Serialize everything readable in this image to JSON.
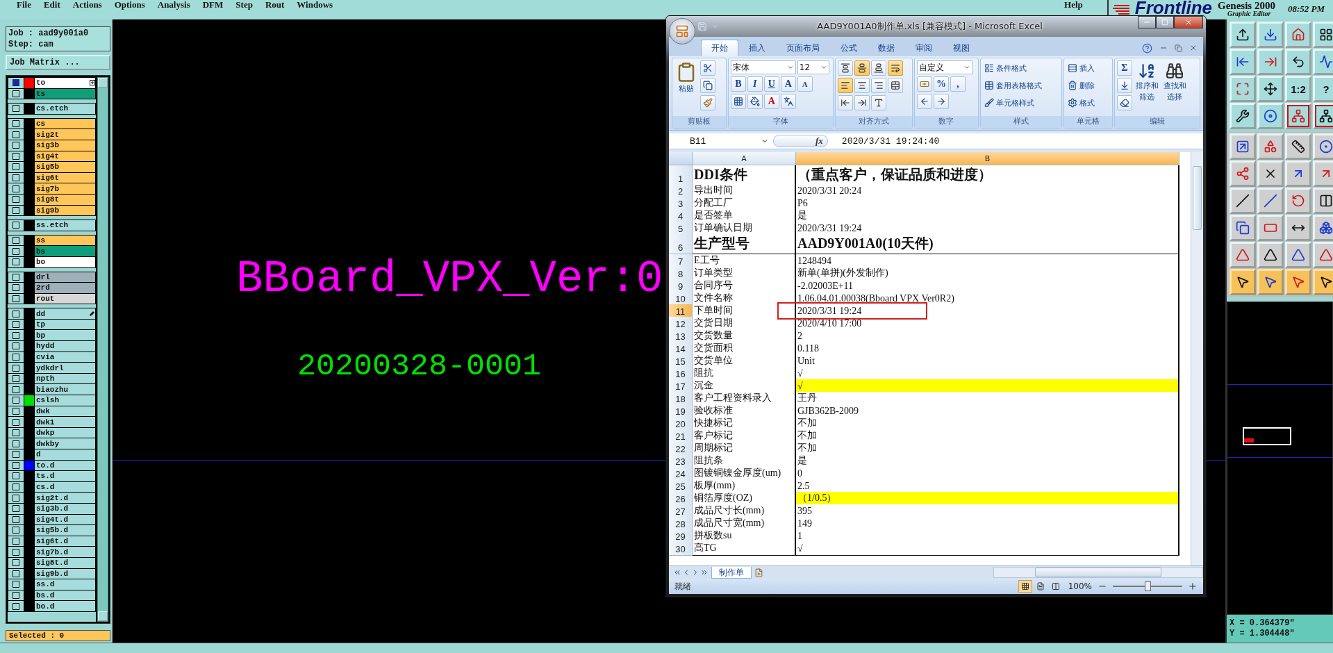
{
  "menu": {
    "items": [
      "File",
      "Edit",
      "Actions",
      "Options",
      "Analysis",
      "DFM",
      "Step",
      "Rout",
      "Windows"
    ],
    "help": "Help",
    "logo": "Frontline",
    "product": "Genesis 2000",
    "subtitle": "Graphic Editor",
    "time": "08:52 PM"
  },
  "left_panel": {
    "job": "Job : aad9y001a0",
    "step": "Step: cam",
    "matrix_button": "Job Matrix ...",
    "selected_count": "Selected : 0",
    "layer_groups": [
      {
        "layers": [
          {
            "name": "to",
            "color": "#ffffff",
            "marker": {
              "color": "#ff0000"
            },
            "checked": true
          },
          {
            "name": "ts",
            "color": "#0f9e7a",
            "checked": false
          }
        ]
      },
      {
        "layers": [
          {
            "name": "cs.etch",
            "color": "#a6dcdc",
            "checked": false
          }
        ]
      },
      {
        "layers": [
          {
            "name": "cs",
            "color": "#ffc65a",
            "checked": false
          },
          {
            "name": "sig2t",
            "color": "#ffc65a",
            "checked": false
          },
          {
            "name": "sig3b",
            "color": "#ffc65a",
            "checked": false
          },
          {
            "name": "sig4t",
            "color": "#ffc65a",
            "checked": false
          },
          {
            "name": "sig5b",
            "color": "#ffc65a",
            "checked": false
          },
          {
            "name": "sig6t",
            "color": "#ffc65a",
            "checked": false
          },
          {
            "name": "sig7b",
            "color": "#ffc65a",
            "checked": false
          },
          {
            "name": "sig8t",
            "color": "#ffc65a",
            "checked": false
          },
          {
            "name": "sig9b",
            "color": "#ffc65a",
            "checked": false
          }
        ]
      },
      {
        "layers": [
          {
            "name": "ss.etch",
            "color": "#a6dcdc",
            "checked": false
          }
        ]
      },
      {
        "layers": [
          {
            "name": "ss",
            "color": "#ffc65a",
            "checked": false
          },
          {
            "name": "bs",
            "color": "#0f9e7a",
            "checked": false
          },
          {
            "name": "bo",
            "color": "#ffffff",
            "checked": false
          }
        ]
      },
      {
        "layers": [
          {
            "name": "drl",
            "color": "#9fb0b8",
            "checked": false
          },
          {
            "name": "2rd",
            "color": "#9fb0b8",
            "checked": false
          },
          {
            "name": "rout",
            "color": "#d8d8d8",
            "checked": false
          }
        ]
      },
      {
        "layers": [
          {
            "name": "dd",
            "color": "#a6dcdc",
            "checked": false
          },
          {
            "name": "tp",
            "color": "#a6dcdc",
            "checked": false
          },
          {
            "name": "bp",
            "color": "#a6dcdc",
            "checked": false
          },
          {
            "name": "hydd",
            "color": "#a6dcdc",
            "checked": false
          },
          {
            "name": "cvia",
            "color": "#a6dcdc",
            "checked": false
          },
          {
            "name": "ydkdrl",
            "color": "#a6dcdc",
            "checked": false
          },
          {
            "name": "npth",
            "color": "#a6dcdc",
            "checked": false
          },
          {
            "name": "biaozhu",
            "color": "#a6dcdc",
            "checked": false
          },
          {
            "name": "cslsh",
            "color": "#a6dcdc",
            "marker": {
              "color": "#00dd00"
            },
            "checked": false
          },
          {
            "name": "dwk",
            "color": "#a6dcdc",
            "checked": false
          },
          {
            "name": "dwk1",
            "color": "#a6dcdc",
            "checked": false
          },
          {
            "name": "dwkp",
            "color": "#a6dcdc",
            "checked": false
          },
          {
            "name": "dwkby",
            "color": "#a6dcdc",
            "checked": false
          },
          {
            "name": "d",
            "color": "#a6dcdc",
            "checked": false
          },
          {
            "name": "to.d",
            "color": "#a6dcdc",
            "marker": {
              "color": "#0000ff"
            },
            "checked": false
          },
          {
            "name": "ts.d",
            "color": "#a6dcdc",
            "checked": false
          },
          {
            "name": "cs.d",
            "color": "#a6dcdc",
            "checked": false
          },
          {
            "name": "sig2t.d",
            "color": "#a6dcdc",
            "checked": false
          },
          {
            "name": "sig3b.d",
            "color": "#a6dcdc",
            "checked": false
          },
          {
            "name": "sig4t.d",
            "color": "#a6dcdc",
            "checked": false
          },
          {
            "name": "sig5b.d",
            "color": "#a6dcdc",
            "checked": false
          },
          {
            "name": "sig6t.d",
            "color": "#a6dcdc",
            "checked": false
          },
          {
            "name": "sig7b.d",
            "color": "#a6dcdc",
            "checked": false
          },
          {
            "name": "sig8t.d",
            "color": "#a6dcdc",
            "checked": false
          },
          {
            "name": "sig9b.d",
            "color": "#a6dcdc",
            "checked": false
          },
          {
            "name": "ss.d",
            "color": "#a6dcdc",
            "checked": false
          },
          {
            "name": "bs.d",
            "color": "#a6dcdc",
            "checked": false
          },
          {
            "name": "bo.d",
            "color": "#a6dcdc",
            "checked": false
          }
        ]
      }
    ]
  },
  "canvas": {
    "texts": [
      {
        "kind": "title",
        "text": "BBoard_VPX_Ver:0",
        "color": "#ff00ff"
      },
      {
        "kind": "code",
        "text": "20200328-0001",
        "color": "#00e000"
      }
    ]
  },
  "tool_groups": [
    {
      "buttons": [
        {
          "selected": false,
          "flagged": false
        },
        {
          "selected": false,
          "flagged": false
        },
        {
          "selected": false,
          "flagged": false
        },
        {
          "selected": false,
          "flagged": false
        },
        {
          "selected": false,
          "flagged": false
        },
        {
          "selected": false,
          "flagged": false
        },
        {
          "selected": false,
          "flagged": false
        },
        {
          "selected": false,
          "flagged": false
        },
        {
          "selected": false,
          "flagged": false
        },
        {
          "selected": false,
          "flagged": false
        },
        {
          "selected": false,
          "flagged": false,
          "label": "1:2"
        },
        {
          "selected": false,
          "flagged": false,
          "label": "?"
        },
        {
          "selected": false,
          "flagged": false
        },
        {
          "selected": false,
          "flagged": false
        },
        {
          "selected": false,
          "flagged": true
        },
        {
          "selected": false,
          "flagged": true
        }
      ]
    },
    {
      "buttons": [
        {
          "selected": false,
          "flagged": false
        },
        {
          "selected": false,
          "flagged": false
        },
        {
          "selected": false,
          "flagged": false
        },
        {
          "selected": false,
          "flagged": false
        },
        {
          "selected": false,
          "flagged": false
        },
        {
          "selected": false,
          "flagged": false
        },
        {
          "selected": false,
          "flagged": false
        },
        {
          "selected": false,
          "flagged": false
        },
        {
          "selected": false,
          "flagged": false
        },
        {
          "selected": false,
          "flagged": false
        },
        {
          "selected": false,
          "flagged": false
        },
        {
          "selected": false,
          "flagged": false
        },
        {
          "selected": false,
          "flagged": false
        },
        {
          "selected": false,
          "flagged": false
        },
        {
          "selected": false,
          "flagged": false
        },
        {
          "selected": false,
          "flagged": false
        },
        {
          "selected": false,
          "flagged": false
        },
        {
          "selected": false,
          "flagged": false
        },
        {
          "selected": false,
          "flagged": false
        },
        {
          "selected": false,
          "flagged": false
        },
        {
          "selected": true,
          "flagged": false
        },
        {
          "selected": true,
          "flagged": false
        },
        {
          "selected": true,
          "flagged": false
        },
        {
          "selected": true,
          "flagged": false
        }
      ]
    }
  ],
  "coordinates": {
    "x": "X = 0.364379\"",
    "y": "Y = 1.304448\""
  },
  "excel": {
    "title": "AAD9Y001A0制作单.xls  [兼容模式] - Microsoft Excel",
    "tabs": [
      {
        "label": "开始",
        "selected": true
      },
      {
        "label": "插入",
        "selected": false
      },
      {
        "label": "页面布局",
        "selected": false
      },
      {
        "label": "公式",
        "selected": false
      },
      {
        "label": "数据",
        "selected": false
      },
      {
        "label": "审阅",
        "selected": false
      },
      {
        "label": "视图",
        "selected": false
      }
    ],
    "groups": [
      {
        "kind": "clipboard",
        "label": "剪贴板",
        "paste": "粘贴"
      },
      {
        "kind": "font",
        "label": "字体",
        "font": "宋体",
        "size": "12",
        "bold": "B",
        "italic": "I",
        "underline": "U",
        "grow": "A",
        "shrink": "A",
        "font_color": "A"
      },
      {
        "kind": "alignment",
        "label": "对齐方式",
        "buttons": [
          {
            "selected": false
          },
          {
            "selected": true
          },
          {
            "selected": false
          },
          {
            "selected": true
          },
          {
            "selected": true
          },
          {
            "selected": false
          },
          {
            "selected": false
          },
          {
            "selected": false
          },
          {
            "selected": false
          },
          {
            "selected": false
          },
          {
            "selected": false
          }
        ]
      },
      {
        "kind": "number",
        "label": "数字",
        "format": "自定义",
        "percent": "%",
        "comma": ","
      },
      {
        "kind": "styles",
        "label": "样式",
        "items": [
          "条件格式",
          "套用表格格式",
          "单元格样式"
        ]
      },
      {
        "kind": "cells",
        "label": "单元格",
        "items": [
          "插入",
          "删除",
          "格式"
        ]
      },
      {
        "kind": "editing",
        "label": "编辑",
        "sum": "Σ",
        "sort": [
          "排序和",
          "筛选"
        ],
        "find": [
          "查找和",
          "选择"
        ]
      }
    ],
    "name_box": "B11",
    "function_label": "fx",
    "formula": "2020/3/31  19:24:40",
    "columns": [
      {
        "label": "A",
        "selected": false
      },
      {
        "label": "B",
        "selected": true
      }
    ],
    "rows": [
      {
        "number": "1",
        "kind": "title",
        "a": "DDI条件",
        "b": "（重点客户，保证品质和进度）",
        "selected": false,
        "boxed": false
      },
      {
        "number": "2",
        "kind": "field",
        "a": "导出时间",
        "b": "2020/3/31 20:24",
        "selected": false,
        "boxed": false
      },
      {
        "number": "3",
        "kind": "field",
        "a": "分配工厂",
        "b": "P6",
        "selected": false,
        "boxed": false
      },
      {
        "number": "4",
        "kind": "field",
        "a": "是否签单",
        "b": "是",
        "selected": false,
        "boxed": false
      },
      {
        "number": "5",
        "kind": "field",
        "a": "订单确认日期",
        "b": "2020/3/31 19:24",
        "selected": false,
        "boxed": false
      },
      {
        "number": "6",
        "kind": "title",
        "a": "生产型号",
        "b": "AAD9Y001A0(10天件)",
        "selected": false,
        "boxed": false
      },
      {
        "number": "7",
        "kind": "field",
        "a": "E工号",
        "b": "1248494",
        "selected": false,
        "boxed": false
      },
      {
        "number": "8",
        "kind": "field",
        "a": "订单类型",
        "b": "新单(单拼)(外发制作)",
        "selected": false,
        "boxed": false
      },
      {
        "number": "9",
        "kind": "field",
        "a": "合同序号",
        "b": "-2.02003E+11",
        "selected": false,
        "boxed": false
      },
      {
        "number": "10",
        "kind": "field",
        "a": "文件名称",
        "b": "1.06.04.01.00038(Bboard VPX Ver0R2)",
        "selected": false,
        "boxed": false
      },
      {
        "number": "11",
        "kind": "field",
        "a": "下单时间",
        "b": "2020/3/31 19:24",
        "selected": true,
        "boxed": true
      },
      {
        "number": "12",
        "kind": "field",
        "a": "交货日期",
        "b": "2020/4/10 17:00",
        "selected": false,
        "boxed": false
      },
      {
        "number": "13",
        "kind": "field",
        "a": "交货数量",
        "b": "2",
        "selected": false,
        "boxed": false
      },
      {
        "number": "14",
        "kind": "field",
        "a": "交货面积",
        "b": "0.118",
        "selected": false,
        "boxed": false
      },
      {
        "number": "15",
        "kind": "field",
        "a": "交货单位",
        "b": "Unit",
        "selected": false,
        "boxed": false
      },
      {
        "number": "16",
        "kind": "field",
        "a": "阻抗",
        "b": "√",
        "selected": false,
        "boxed": false
      },
      {
        "number": "17",
        "kind": "field",
        "a": "沉金",
        "b": "√",
        "color": "#ffff00",
        "selected": false,
        "boxed": false
      },
      {
        "number": "18",
        "kind": "field",
        "a": "客户工程资料录入",
        "b": "王丹",
        "selected": false,
        "boxed": false
      },
      {
        "number": "19",
        "kind": "field",
        "a": "验收标准",
        "b": "GJB362B-2009",
        "selected": false,
        "boxed": false
      },
      {
        "number": "20",
        "kind": "field",
        "a": "快捷标记",
        "b": "不加",
        "selected": false,
        "boxed": false
      },
      {
        "number": "21",
        "kind": "field",
        "a": "客户标记",
        "b": "不加",
        "selected": false,
        "boxed": false
      },
      {
        "number": "22",
        "kind": "field",
        "a": "周期标记",
        "b": "不加",
        "selected": false,
        "boxed": false
      },
      {
        "number": "23",
        "kind": "field",
        "a": "阻抗条",
        "b": "是",
        "selected": false,
        "boxed": false
      },
      {
        "number": "24",
        "kind": "field",
        "a": "图镀铜镍金厚度(um)",
        "b": "0",
        "selected": false,
        "boxed": false
      },
      {
        "number": "25",
        "kind": "field",
        "a": "板厚(mm)",
        "b": "2.5",
        "selected": false,
        "boxed": false
      },
      {
        "number": "26",
        "kind": "field",
        "a": "铜箔厚度(OZ)",
        "b": "（1/0.5）",
        "color": "#ffff00",
        "selected": false,
        "boxed": false
      },
      {
        "number": "27",
        "kind": "field",
        "a": "成品尺寸长(mm)",
        "b": "395",
        "selected": false,
        "boxed": false
      },
      {
        "number": "28",
        "kind": "field",
        "a": "成品尺寸宽(mm)",
        "b": "149",
        "selected": false,
        "boxed": false
      },
      {
        "number": "29",
        "kind": "field",
        "a": "拼板数su",
        "b": "1",
        "selected": false,
        "boxed": false
      },
      {
        "number": "30",
        "kind": "field",
        "a": "高TG",
        "b": "√",
        "selected": false,
        "boxed": false
      }
    ],
    "sheets": [
      {
        "label": "制作单",
        "selected": true
      }
    ],
    "status": "就绪",
    "zoom": "100%",
    "zoom_slider": {
      "level": 0.5
    }
  }
}
